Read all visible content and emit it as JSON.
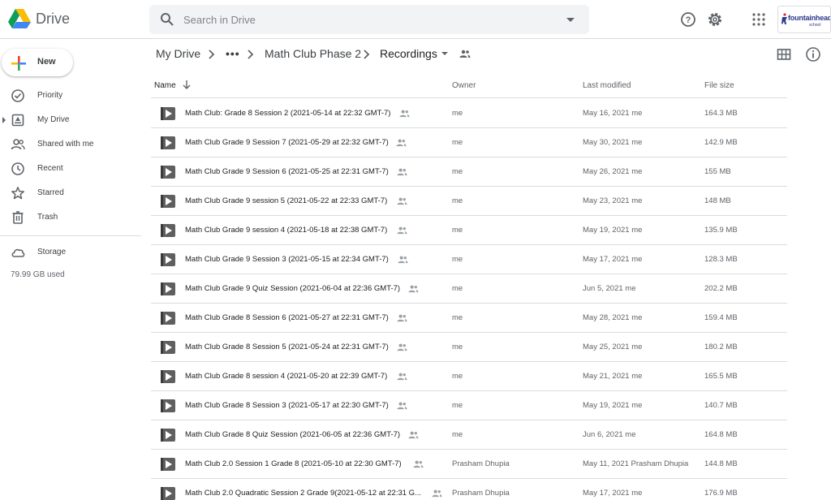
{
  "app": {
    "brand": "Drive"
  },
  "search": {
    "placeholder": "Search in Drive"
  },
  "org": {
    "line1": "fountainhead",
    "line2": "school"
  },
  "sidebar": {
    "new_label": "New",
    "items": [
      {
        "label": "Priority",
        "icon": "priority-icon"
      },
      {
        "label": "My Drive",
        "icon": "my-drive-icon"
      },
      {
        "label": "Shared with me",
        "icon": "shared-icon"
      },
      {
        "label": "Recent",
        "icon": "clock-icon"
      },
      {
        "label": "Starred",
        "icon": "star-icon"
      },
      {
        "label": "Trash",
        "icon": "trash-icon"
      }
    ],
    "storage_label": "Storage",
    "storage_used": "79.99 GB used"
  },
  "breadcrumb": {
    "root": "My Drive",
    "ellipsis": "•••",
    "parent": "Math Club Phase 2",
    "current": "Recordings"
  },
  "table": {
    "headers": {
      "name": "Name",
      "owner": "Owner",
      "modified": "Last modified",
      "size": "File size"
    },
    "rows": [
      {
        "name": "Math Club: Grade 8 Session 2 (2021-05-14 at 22:32 GMT-7)",
        "owner": "me",
        "modified": "May 16, 2021  me",
        "size": "164.3 MB"
      },
      {
        "name": "Math Club Grade 9 Session 7  (2021-05-29 at 22:32 GMT-7)",
        "owner": "me",
        "modified": "May 30, 2021  me",
        "size": "142.9 MB"
      },
      {
        "name": "Math Club Grade 9 Session 6 (2021-05-25 at 22:31 GMT-7)",
        "owner": "me",
        "modified": "May 26, 2021  me",
        "size": "155 MB"
      },
      {
        "name": "Math Club Grade 9 session 5 (2021-05-22 at 22:33 GMT-7)",
        "owner": "me",
        "modified": "May 23, 2021  me",
        "size": "148 MB"
      },
      {
        "name": "Math Club Grade 9 session 4 (2021-05-18 at 22:38 GMT-7)",
        "owner": "me",
        "modified": "May 19, 2021  me",
        "size": "135.9 MB"
      },
      {
        "name": "Math Club Grade 9 Session 3 (2021-05-15 at 22:34 GMT-7)",
        "owner": "me",
        "modified": "May 17, 2021  me",
        "size": "128.3 MB"
      },
      {
        "name": "Math Club Grade 9 Quiz Session (2021-06-04 at 22:36 GMT-7)",
        "owner": "me",
        "modified": "Jun 5, 2021  me",
        "size": "202.2 MB"
      },
      {
        "name": "Math Club Grade 8 Session 6 (2021-05-27 at 22:31 GMT-7)",
        "owner": "me",
        "modified": "May 28, 2021  me",
        "size": "159.4 MB"
      },
      {
        "name": "Math Club Grade 8 Session 5 (2021-05-24 at 22:31 GMT-7)",
        "owner": "me",
        "modified": "May 25, 2021  me",
        "size": "180.2 MB"
      },
      {
        "name": "Math Club Grade 8 session 4 (2021-05-20 at 22:39 GMT-7)",
        "owner": "me",
        "modified": "May 21, 2021  me",
        "size": "165.5 MB"
      },
      {
        "name": "Math Club Grade 8 Session 3 (2021-05-17 at 22:30 GMT-7)",
        "owner": "me",
        "modified": "May 19, 2021  me",
        "size": "140.7 MB"
      },
      {
        "name": "Math Club Grade 8 Quiz Session (2021-06-05 at 22:36 GMT-7)",
        "owner": "me",
        "modified": "Jun 6, 2021  me",
        "size": "164.8 MB"
      },
      {
        "name": "Math Club 2.0 Session 1 Grade 8 (2021-05-10 at 22:30 GMT-7)",
        "owner": "Prasham Dhupia",
        "modified": "May 11, 2021  Prasham Dhupia",
        "size": "144.8 MB"
      },
      {
        "name": "Math Club 2.0 Quadratic Session 2 Grade 9(2021-05-12 at 22:31 G...",
        "owner": "Prasham Dhupia",
        "modified": "May 17, 2021  me",
        "size": "176.9 MB"
      }
    ]
  }
}
